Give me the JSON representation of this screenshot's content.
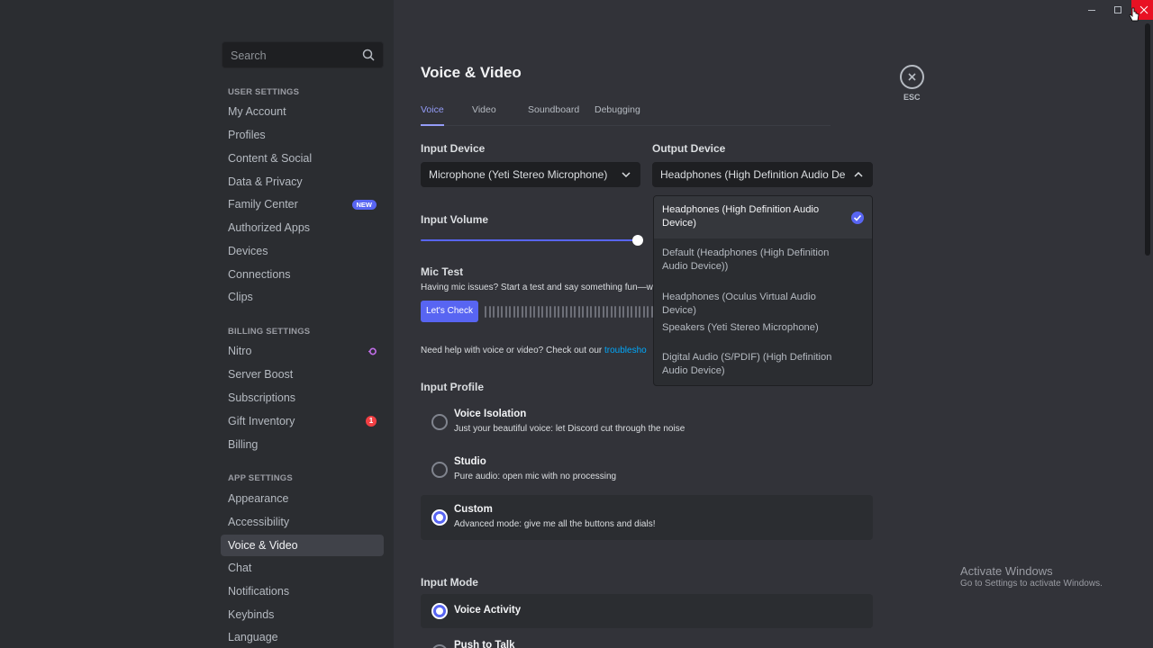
{
  "sidebar": {
    "search_placeholder": "Search",
    "user_settings_header": "USER SETTINGS",
    "user_items": [
      "My Account",
      "Profiles",
      "Content & Social",
      "Data & Privacy",
      "Family Center",
      "Authorized Apps",
      "Devices",
      "Connections",
      "Clips"
    ],
    "new_badge": "NEW",
    "billing_settings_header": "BILLING SETTINGS",
    "billing_items": [
      "Nitro",
      "Server Boost",
      "Subscriptions",
      "Gift Inventory",
      "Billing"
    ],
    "gift_count": "1",
    "app_settings_header": "APP SETTINGS",
    "app_items": [
      "Appearance",
      "Accessibility",
      "Voice & Video",
      "Chat",
      "Notifications",
      "Keybinds",
      "Language"
    ],
    "active_item": "Voice & Video"
  },
  "page": {
    "title": "Voice & Video",
    "tabs": [
      "Voice",
      "Video",
      "Soundboard",
      "Debugging"
    ],
    "active_tab": "Voice",
    "input_device_label": "Input Device",
    "input_device_value": "Microphone (Yeti Stereo Microphone)",
    "output_device_label": "Output Device",
    "output_device_value": "Headphones (High Definition Audio Device)",
    "input_volume_label": "Input Volume",
    "input_volume_level": 1.0,
    "mic_test_label": "Mic Test",
    "mic_test_desc": "Having mic issues? Start a test and say something fun—w",
    "lets_check_label": "Let's Check",
    "help_text": "Need help with voice or video? Check out our ",
    "help_link": "troublesho",
    "input_profile_label": "Input Profile",
    "profiles": [
      {
        "title": "Voice Isolation",
        "desc": "Just your beautiful voice: let Discord cut through the noise",
        "selected": false
      },
      {
        "title": "Studio",
        "desc": "Pure audio: open mic with no processing",
        "selected": false
      },
      {
        "title": "Custom",
        "desc": "Advanced mode: give me all the buttons and dials!",
        "selected": true
      }
    ],
    "input_mode_label": "Input Mode",
    "modes": [
      {
        "title": "Voice Activity",
        "selected": true
      },
      {
        "title": "Push to Talk",
        "selected": false
      }
    ],
    "esc_label": "ESC"
  },
  "dropdown": {
    "options": [
      "Headphones (High Definition Audio Device)",
      "Default (Headphones (High Definition Audio Device))",
      "Headphones (Oculus Virtual Audio Device)",
      "Speakers (Yeti Stereo Microphone)",
      "Digital Audio (S/PDIF) (High Definition Audio Device)"
    ],
    "selected_index": 0
  },
  "watermark": {
    "title": "Activate Windows",
    "subtitle": "Go to Settings to activate Windows."
  },
  "colors": {
    "accent": "#5865f2",
    "link": "#00a8fc",
    "danger": "#f23f43"
  }
}
